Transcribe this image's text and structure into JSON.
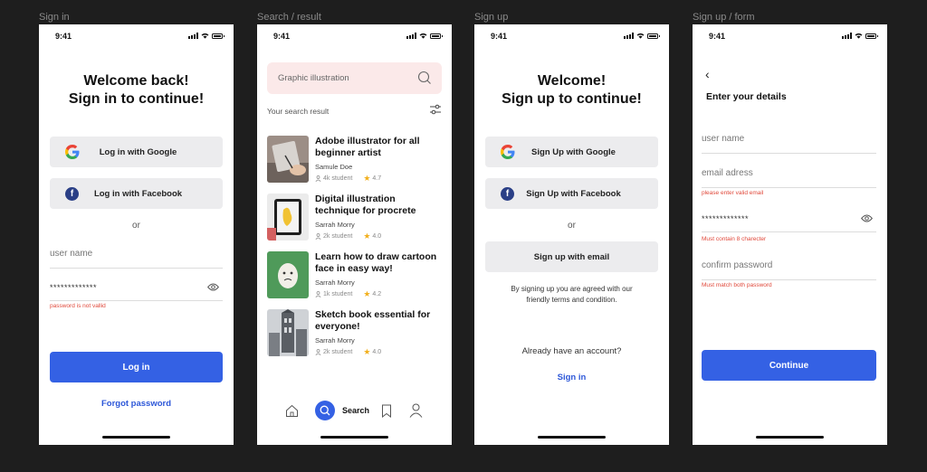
{
  "frames": {
    "signin": "Sign in",
    "search": "Search / result",
    "signup": "Sign up",
    "form": "Sign up / form"
  },
  "status": {
    "time": "9:41"
  },
  "signin": {
    "title_line1": "Welcome back!",
    "title_line2": "Sign in to continue!",
    "google_label": "Log in with Google",
    "facebook_label": "Log in with Facebook",
    "or": "or",
    "username_value": "user name",
    "password_value": "*************",
    "password_error": "password is not vallid",
    "login_label": "Log in",
    "forgot_label": "Forgot password"
  },
  "search": {
    "placeholder": "Graphic illustration",
    "result_label": "Your search result",
    "courses": [
      {
        "title": "Adobe illustrator for all beginner artist",
        "author": "Samule Doe",
        "students": "4k student",
        "rating": "4.7"
      },
      {
        "title": "Digital illustration technique for procrete",
        "author": "Sarrah Morry",
        "students": "2k student",
        "rating": "4.0"
      },
      {
        "title": "Learn how to draw cartoon face in easy way!",
        "author": "Sarrah Morry",
        "students": "1k student",
        "rating": "4.2"
      },
      {
        "title": "Sketch book essential for everyone!",
        "author": "Sarrah Morry",
        "students": "2k student",
        "rating": "4.0"
      }
    ],
    "nav_search_label": "Search"
  },
  "signup": {
    "title_line1": "Welcome!",
    "title_line2": "Sign up to continue!",
    "google_label": "Sign Up with Google",
    "facebook_label": "Sign Up with Facebook",
    "or": "or",
    "email_label": "Sign up with email",
    "terms_line1": "By signing up you are agreed with our",
    "terms_line2": "friendly terms and condition.",
    "already": "Already have an account?",
    "signin_link": "Sign in"
  },
  "form": {
    "back": "‹",
    "title": "Enter your details",
    "username": "user name",
    "email": "email adress",
    "email_error": "please enter valid email",
    "password": "*************",
    "password_error": "Must contain 8 charecter",
    "confirm": "confirm password",
    "confirm_error": "Must match both password",
    "continue_label": "Continue"
  },
  "colors": {
    "primary": "#3461e4",
    "error": "#e0483a",
    "link": "#2d57d8"
  }
}
